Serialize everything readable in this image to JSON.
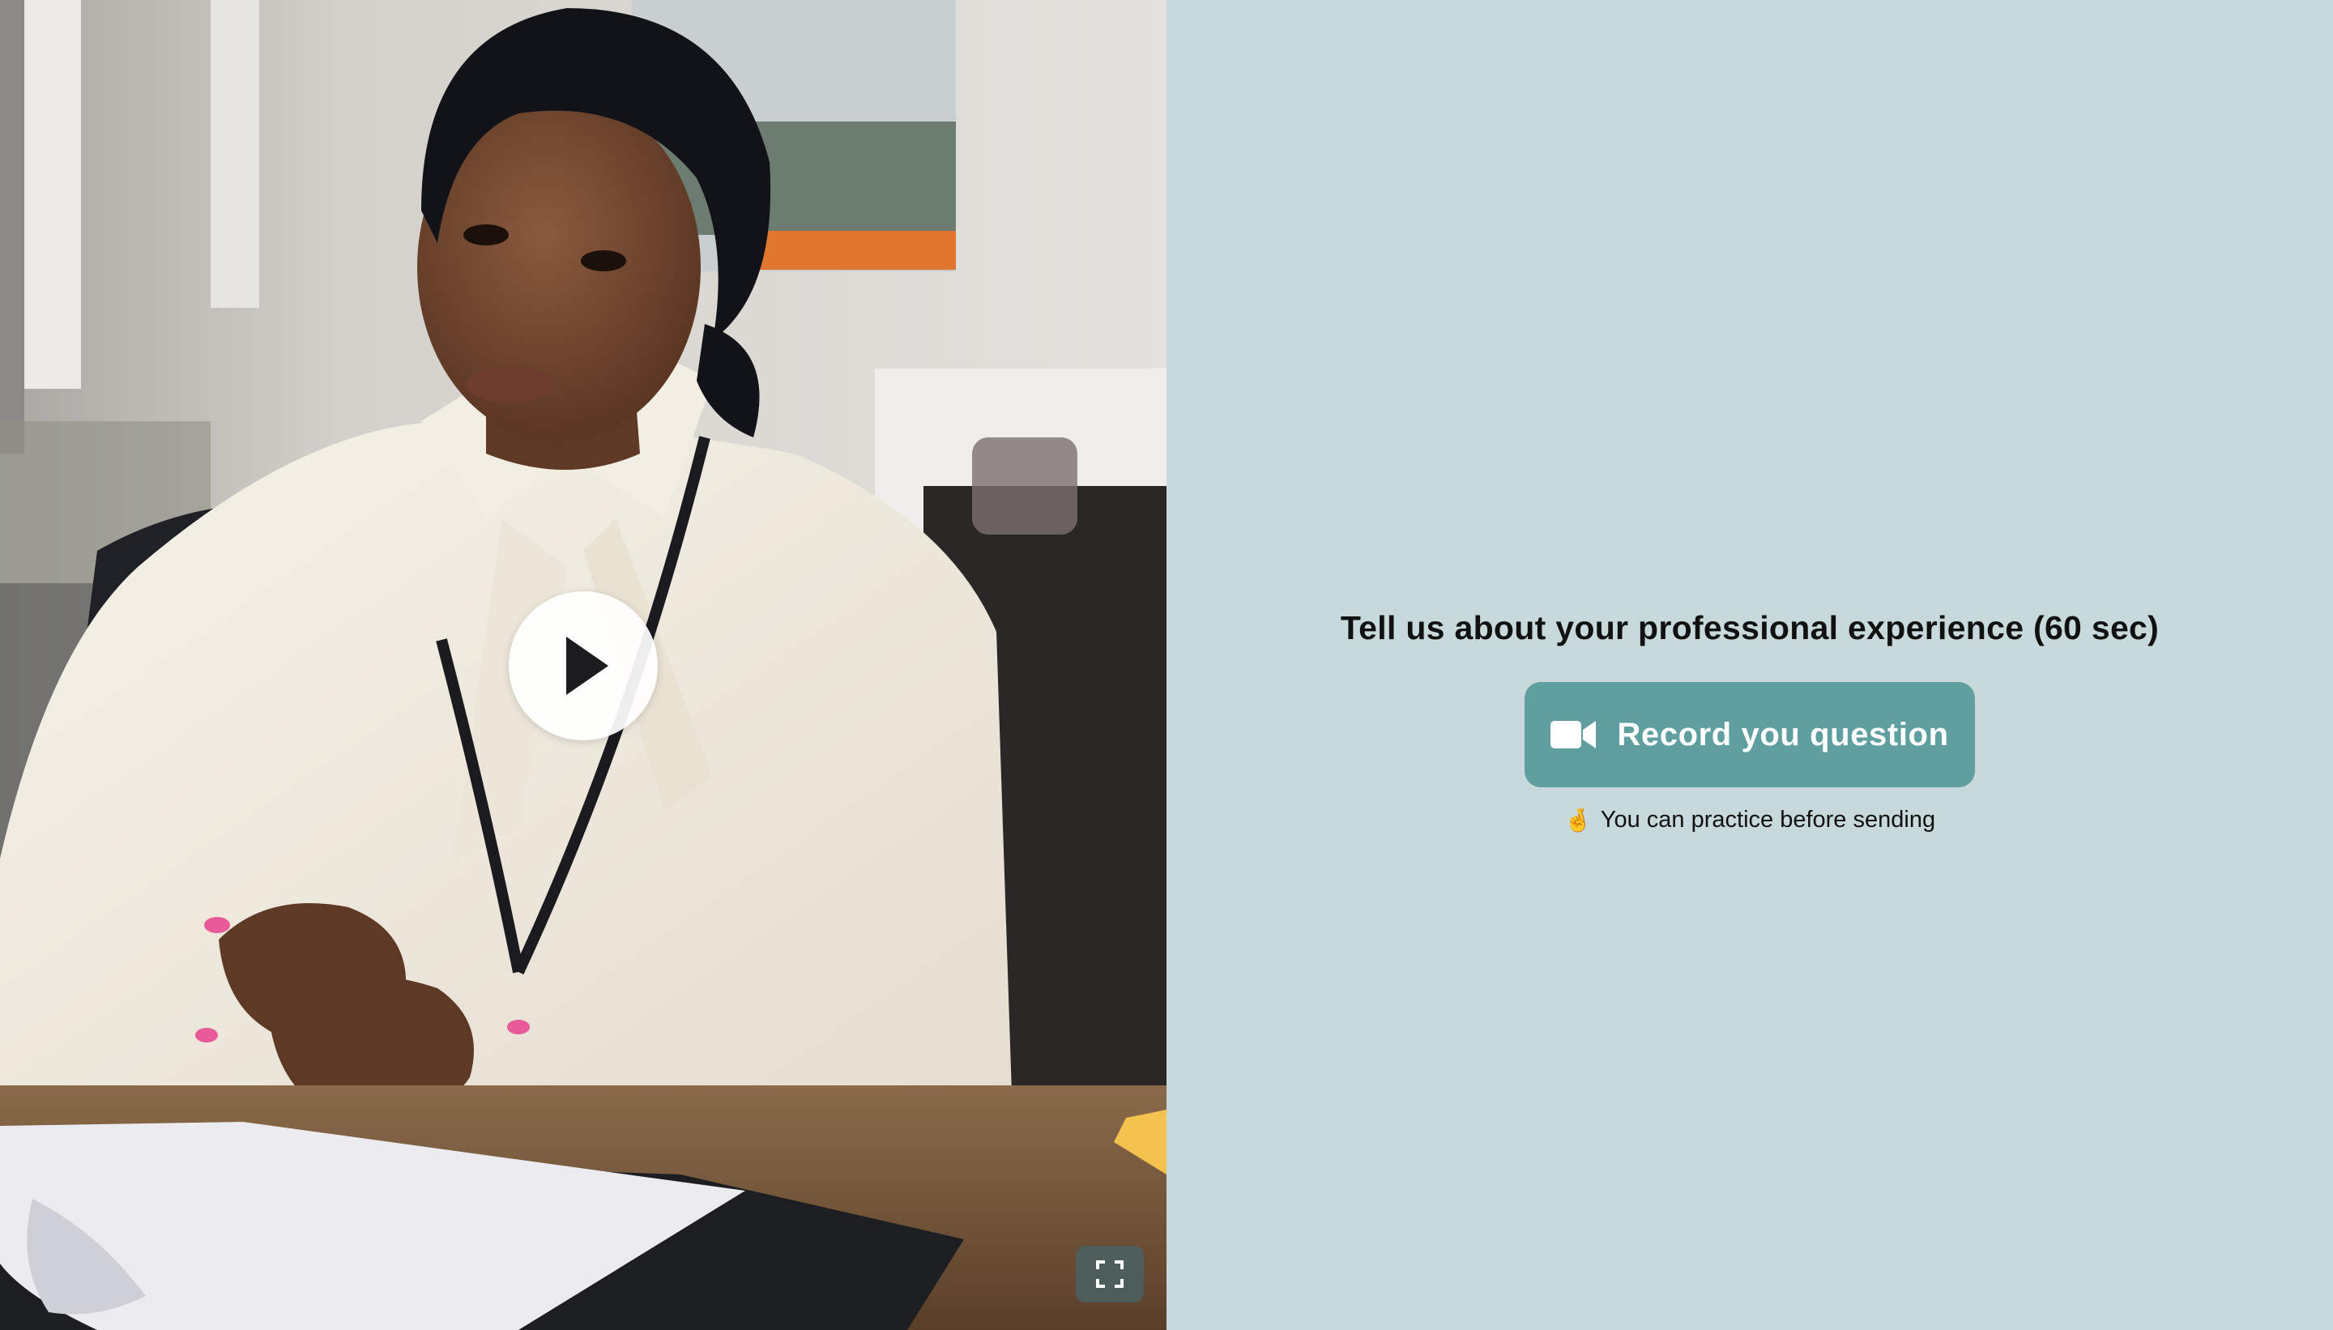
{
  "video": {
    "play_icon": "play-icon",
    "fullscreen_icon": "fullscreen-icon"
  },
  "prompt": {
    "question": "Tell us about your professional experience (60 sec)",
    "record_button_label": "Record you question",
    "record_icon": "video-camera-icon",
    "hint_emoji": "🤞",
    "hint_text": "You can practice before sending"
  },
  "colors": {
    "panel_background": "#c8d9db",
    "accent_button": "#5f9fa0"
  }
}
